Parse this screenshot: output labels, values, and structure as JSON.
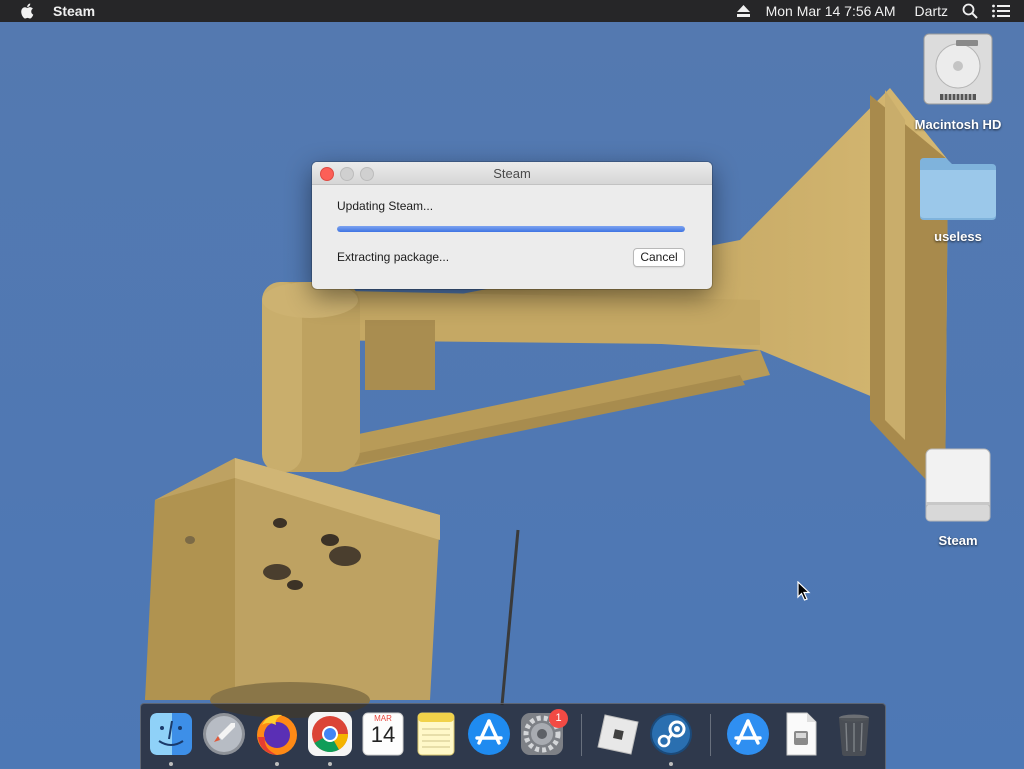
{
  "menubar": {
    "app_name": "Steam",
    "datetime": "Mon Mar 14  7:56 AM",
    "user": "Dartz",
    "icons": [
      "apple-icon",
      "eject-icon",
      "search-icon",
      "list-icon"
    ]
  },
  "dialog": {
    "title": "Steam",
    "status": "Updating Steam...",
    "progress": 1.0,
    "detail": "Extracting package...",
    "cancel_label": "Cancel",
    "accent": "#3f74e3"
  },
  "desktop": {
    "icons": [
      {
        "label": "Macintosh HD",
        "icon": "hard-drive-icon"
      },
      {
        "label": "useless",
        "icon": "folder-icon"
      },
      {
        "label": "Steam",
        "icon": "external-drive-icon"
      }
    ]
  },
  "dock": {
    "items": [
      {
        "icon": "finder-icon",
        "running": true
      },
      {
        "icon": "launchpad-icon",
        "running": false
      },
      {
        "icon": "firefox-icon",
        "running": true
      },
      {
        "icon": "chrome-icon",
        "running": true
      },
      {
        "icon": "calendar-icon",
        "running": false,
        "month": "MAR",
        "day": "14"
      },
      {
        "icon": "notes-icon",
        "running": false
      },
      {
        "icon": "app-store-icon",
        "running": false
      },
      {
        "icon": "system-preferences-icon",
        "running": false,
        "badge": "1"
      },
      {
        "icon": "roblox-icon",
        "running": false
      },
      {
        "icon": "steam-icon",
        "running": true
      },
      {
        "icon": "downloads-folder-icon",
        "running": false
      },
      {
        "icon": "document-icon",
        "running": false
      },
      {
        "icon": "trash-icon",
        "running": false
      }
    ]
  },
  "colors": {
    "sky": "#4f7ab4",
    "siren_body": "#c8ac66",
    "menubar": "#262628"
  }
}
